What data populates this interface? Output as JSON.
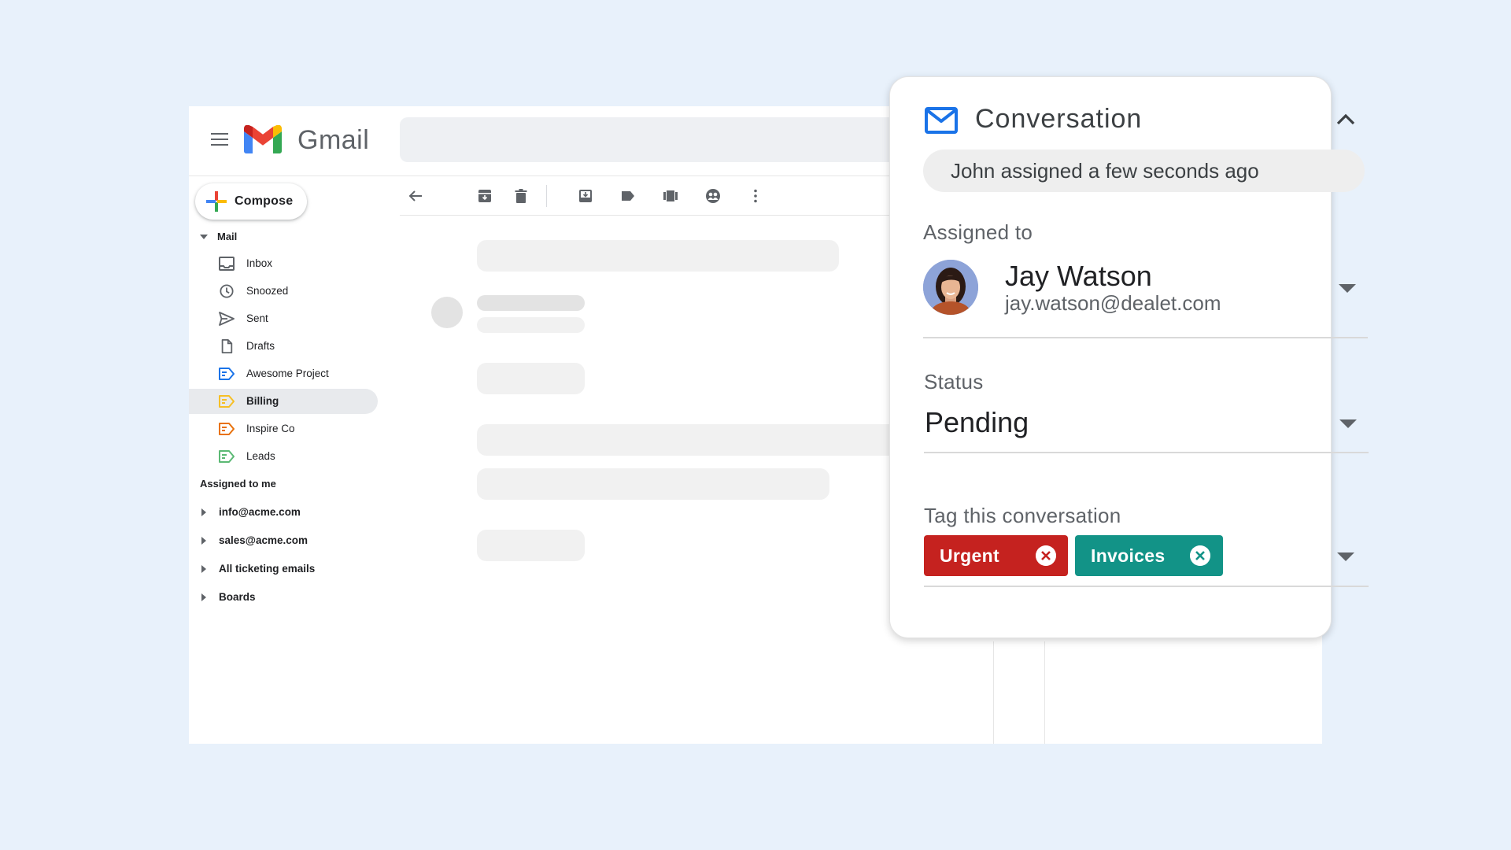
{
  "gmail": {
    "app_name": "Gmail",
    "compose_label": "Compose",
    "mail_section": "Mail",
    "mail_items": [
      {
        "label": "Inbox",
        "icon": "inbox-icon"
      },
      {
        "label": "Snoozed",
        "icon": "clock-icon"
      },
      {
        "label": "Sent",
        "icon": "send-icon"
      },
      {
        "label": "Drafts",
        "icon": "draft-icon"
      },
      {
        "label": "Awesome Project",
        "icon": "label-icon",
        "color": "#1a73e8"
      },
      {
        "label": "Billing",
        "icon": "label-icon",
        "color": "#f6bf26",
        "active": true
      },
      {
        "label": "Inspire Co",
        "icon": "label-icon",
        "color": "#e8710a"
      },
      {
        "label": "Leads",
        "icon": "label-icon",
        "color": "#5bb974"
      }
    ],
    "assigned_section": "Assigned to me",
    "assigned_items": [
      {
        "label": "info@acme.com"
      },
      {
        "label": "sales@acme.com"
      },
      {
        "label": "All ticketing emails"
      },
      {
        "label": "Boards"
      }
    ],
    "toolbar_icons": [
      "back-arrow-icon",
      "archive-icon",
      "delete-icon",
      "move-to-inbox-icon",
      "label-tag-icon",
      "board-icon",
      "assign-icon",
      "more-vert-icon"
    ]
  },
  "conversation": {
    "title": "Conversation",
    "activity": "John assigned a few seconds ago",
    "assigned_label": "Assigned to",
    "assignee": {
      "name": "Jay Watson",
      "email": "jay.watson@dealet.com"
    },
    "status_label": "Status",
    "status_value": "Pending",
    "tag_label": "Tag this conversation",
    "tags": [
      {
        "label": "Urgent",
        "color": "#c5221f"
      },
      {
        "label": "Invoices",
        "color": "#129387"
      }
    ]
  },
  "colors": {
    "background": "#e8f1fb",
    "accent_blue": "#1a73e8"
  }
}
